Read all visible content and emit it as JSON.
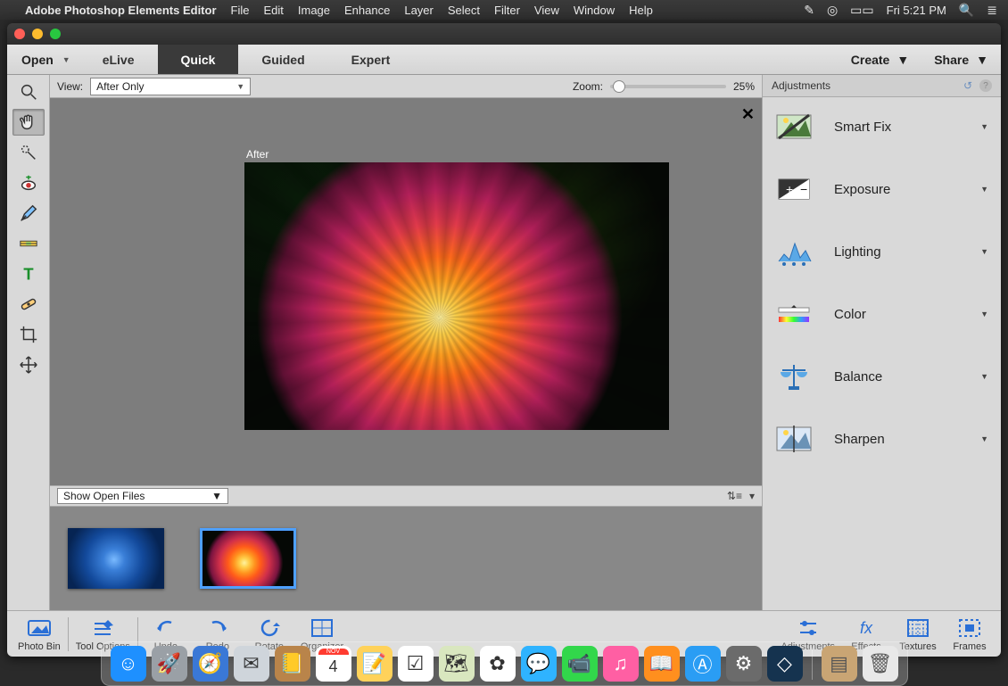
{
  "menubar": {
    "appname": "Adobe Photoshop Elements Editor",
    "items": [
      "File",
      "Edit",
      "Image",
      "Enhance",
      "Layer",
      "Select",
      "Filter",
      "View",
      "Window",
      "Help"
    ],
    "clock": "Fri 5:21 PM"
  },
  "appbar": {
    "open": "Open",
    "tabs": [
      "eLive",
      "Quick",
      "Guided",
      "Expert"
    ],
    "active_tab": "Quick",
    "create": "Create",
    "share": "Share"
  },
  "tools": [
    {
      "name": "zoom-tool",
      "glyph": "zoom"
    },
    {
      "name": "hand-tool",
      "glyph": "hand",
      "selected": true
    },
    {
      "name": "quick-selection-tool",
      "glyph": "wand"
    },
    {
      "name": "redeye-tool",
      "glyph": "eye"
    },
    {
      "name": "whiten-teeth-tool",
      "glyph": "brush"
    },
    {
      "name": "straighten-tool",
      "glyph": "level"
    },
    {
      "name": "type-tool",
      "glyph": "T"
    },
    {
      "name": "spot-healing-tool",
      "glyph": "bandage"
    },
    {
      "name": "crop-tool",
      "glyph": "crop"
    },
    {
      "name": "move-tool",
      "glyph": "move"
    }
  ],
  "viewbar": {
    "label": "View:",
    "mode": "After Only",
    "zoom_label": "Zoom:",
    "zoom_value": "25%"
  },
  "canvas": {
    "label": "After"
  },
  "binbar": {
    "mode": "Show Open Files"
  },
  "adjust": {
    "title": "Adjustments",
    "items": [
      {
        "name": "smart-fix",
        "label": "Smart Fix",
        "icon": "smartfix"
      },
      {
        "name": "exposure",
        "label": "Exposure",
        "icon": "exposure"
      },
      {
        "name": "lighting",
        "label": "Lighting",
        "icon": "lighting"
      },
      {
        "name": "color",
        "label": "Color",
        "icon": "color"
      },
      {
        "name": "balance",
        "label": "Balance",
        "icon": "balance"
      },
      {
        "name": "sharpen",
        "label": "Sharpen",
        "icon": "sharpen"
      }
    ]
  },
  "bottombar": {
    "left": [
      {
        "name": "photo-bin",
        "label": "Photo Bin",
        "icon": "photobin"
      },
      {
        "name": "tool-options",
        "label": "Tool Options",
        "icon": "tooloptions"
      },
      {
        "name": "undo",
        "label": "Undo",
        "icon": "undo"
      },
      {
        "name": "redo",
        "label": "Redo",
        "icon": "redo"
      },
      {
        "name": "rotate",
        "label": "Rotate",
        "icon": "rotate"
      },
      {
        "name": "organizer",
        "label": "Organizer",
        "icon": "grid"
      }
    ],
    "right": [
      {
        "name": "adjustments-btn",
        "label": "Adjustments",
        "icon": "sliders"
      },
      {
        "name": "effects-btn",
        "label": "Effects",
        "icon": "fx"
      },
      {
        "name": "textures-btn",
        "label": "Textures",
        "icon": "texture"
      },
      {
        "name": "frames-btn",
        "label": "Frames",
        "icon": "frame"
      }
    ]
  },
  "dock": {
    "apps": [
      {
        "name": "finder",
        "c": "#1e90ff"
      },
      {
        "name": "launchpad",
        "c": "#9aa0a6"
      },
      {
        "name": "safari",
        "c": "#3a78d6"
      },
      {
        "name": "mail",
        "c": "#cfd5db"
      },
      {
        "name": "contacts",
        "c": "#b9844a"
      },
      {
        "name": "calendar",
        "c": "#ffffff"
      },
      {
        "name": "notes",
        "c": "#ffd25a"
      },
      {
        "name": "reminders",
        "c": "#ffffff"
      },
      {
        "name": "maps",
        "c": "#d9e7bf"
      },
      {
        "name": "photos",
        "c": "#ffffff"
      },
      {
        "name": "messages",
        "c": "#2fb3ff"
      },
      {
        "name": "facetime",
        "c": "#32d74b"
      },
      {
        "name": "itunes",
        "c": "#ff5fa3"
      },
      {
        "name": "ibooks",
        "c": "#ff8f1e"
      },
      {
        "name": "appstore",
        "c": "#2a9df4"
      },
      {
        "name": "preferences",
        "c": "#6b6b6b"
      },
      {
        "name": "pse",
        "c": "#15334f"
      }
    ],
    "right": [
      {
        "name": "downloads",
        "c": "#c9a574"
      },
      {
        "name": "trash",
        "c": "#e8e8e8"
      }
    ]
  }
}
